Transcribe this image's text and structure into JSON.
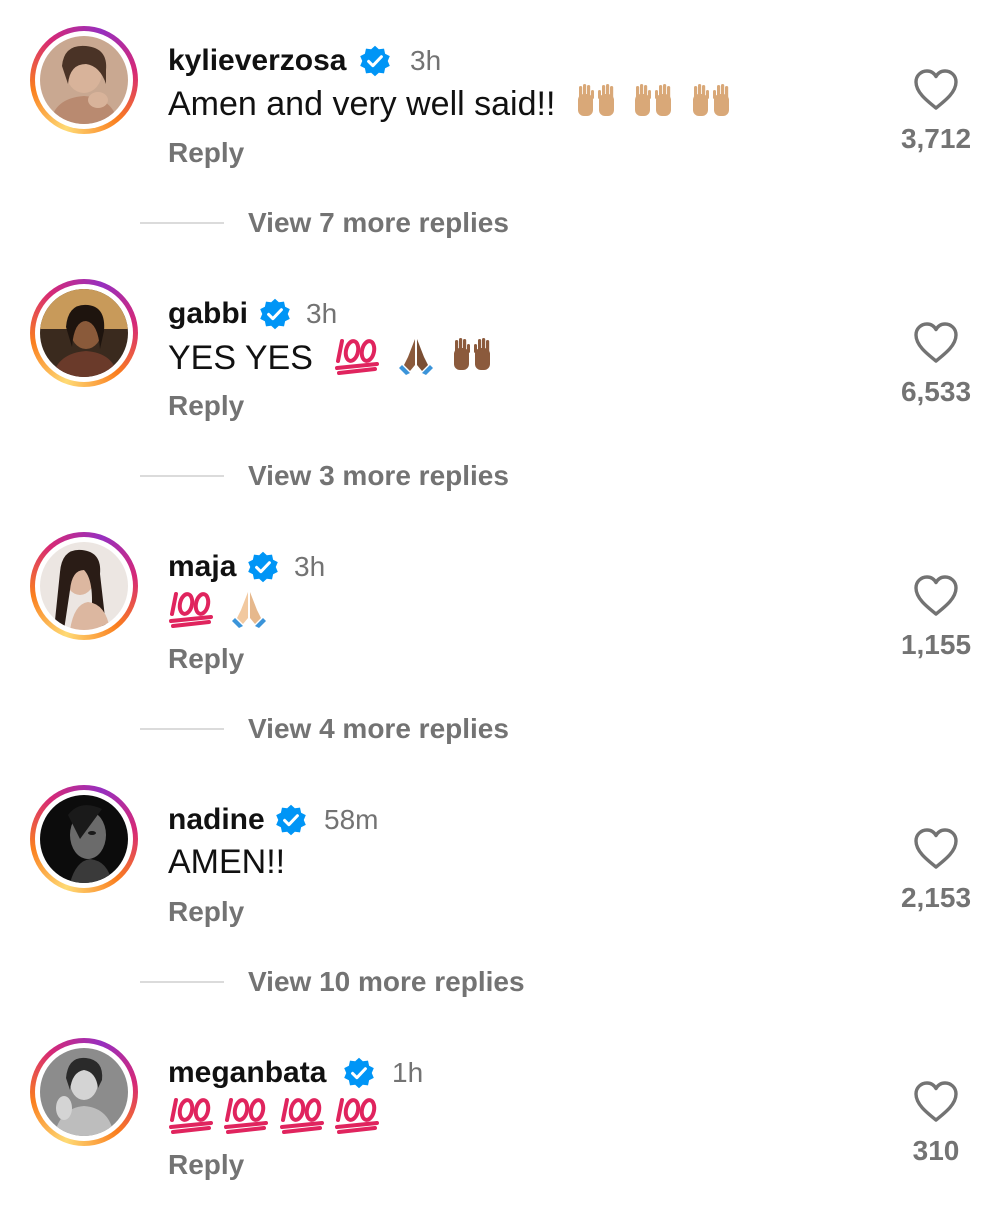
{
  "comments": [
    {
      "username": "kylieverzosa",
      "time": "3h",
      "text": "Amen and very well said!!",
      "emoji_icons": [
        "raising-hands-icon",
        "raising-hands-icon",
        "raising-hands-icon"
      ],
      "reply_label": "Reply",
      "likes": "3,712",
      "more_replies": "View 7 more replies"
    },
    {
      "username": "gabbi",
      "time": "3h",
      "text": "YES YES",
      "emoji_icons": [
        "hundred-points-icon",
        "folded-hands-icon",
        "raising-hands-icon"
      ],
      "reply_label": "Reply",
      "likes": "6,533",
      "more_replies": "View 3 more replies"
    },
    {
      "username": "maja",
      "time": "3h",
      "text": "",
      "emoji_icons": [
        "hundred-points-icon",
        "folded-hands-icon"
      ],
      "reply_label": "Reply",
      "likes": "1,155",
      "more_replies": "View 4 more replies"
    },
    {
      "username": "nadine",
      "time": "58m",
      "text": "AMEN!!",
      "emoji_icons": [],
      "reply_label": "Reply",
      "likes": "2,153",
      "more_replies": "View 10 more replies"
    },
    {
      "username": "meganbata",
      "time": "1h",
      "text": "",
      "emoji_icons": [
        "hundred-points-icon",
        "hundred-points-icon",
        "hundred-points-icon",
        "hundred-points-icon"
      ],
      "reply_label": "Reply",
      "likes": "310",
      "more_replies": ""
    }
  ],
  "colors": {
    "verified_badge": "#0095f6",
    "secondary_text": "#737373",
    "primary_text": "#111111",
    "divider": "#dbdbdb"
  }
}
